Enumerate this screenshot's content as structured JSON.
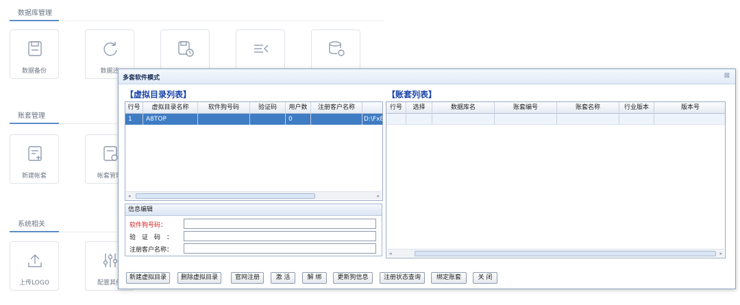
{
  "background": {
    "sections": [
      {
        "title": "数据库管理",
        "tiles": [
          {
            "label": "数据备份",
            "icon": "save-icon"
          },
          {
            "label": "数据还",
            "icon": "restore-icon"
          },
          {
            "label": "",
            "icon": "scheduled-backup-icon"
          },
          {
            "label": "",
            "icon": "list-collapse-icon"
          },
          {
            "label": "",
            "icon": "database-settings-icon"
          }
        ]
      },
      {
        "title": "账套管理",
        "tiles": [
          {
            "label": "新建帐套",
            "icon": "new-document-icon"
          },
          {
            "label": "帐套管理",
            "icon": "document-settings-icon"
          }
        ]
      },
      {
        "title": "系统相关",
        "tiles": [
          {
            "label": "上传LOGO",
            "icon": "upload-icon"
          },
          {
            "label": "配置其他",
            "icon": "sliders-icon"
          }
        ]
      }
    ]
  },
  "dialog": {
    "title": "多套软件模式",
    "close_glyph": "⊠",
    "virtual_list": {
      "title": "【虚拟目录列表】",
      "columns": [
        "行号",
        "虚拟目录名称",
        "软件狗号码",
        "验证码",
        "用户数",
        "注册客户名称",
        ""
      ],
      "rows": [
        {
          "cells": [
            "1",
            "A8TOP",
            "",
            "",
            "0",
            "",
            "D:\\FxE"
          ]
        }
      ]
    },
    "account_list": {
      "title": "【账套列表】",
      "columns": [
        "行号",
        "选择",
        "数据库名",
        "账套编号",
        "账套名称",
        "行业版本",
        "版本号"
      ]
    },
    "info": {
      "title": "信息编辑",
      "fields": [
        {
          "label": "软件狗号码：",
          "value": ""
        },
        {
          "label": "验　证　码　：",
          "value": ""
        },
        {
          "label": "注册客户名称：",
          "value": ""
        }
      ]
    },
    "buttons": [
      "新建虚拟目录",
      "删除虚拟目录",
      "官网注册",
      "激 活",
      "解 绑",
      "更新狗信息",
      "注册状态查询",
      "绑定账套",
      "关 闭"
    ],
    "colors": {
      "title_blue": "#1842a8",
      "selected_row": "#3e7cc4",
      "required_label": "#d02020"
    }
  }
}
